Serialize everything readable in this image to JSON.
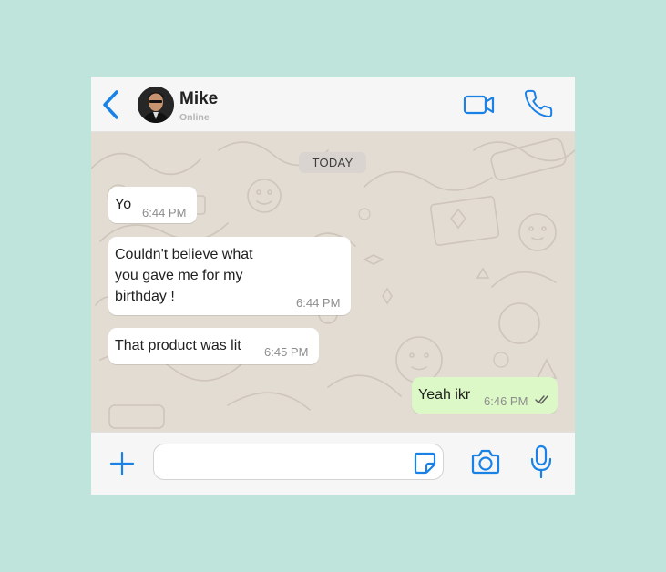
{
  "header": {
    "contact_name": "Mike",
    "contact_status": "Online",
    "icons": [
      "back-chevron-icon",
      "avatar",
      "video-call-icon",
      "phone-call-icon"
    ]
  },
  "chat": {
    "date_divider": "TODAY",
    "messages": [
      {
        "direction": "incoming",
        "text": "Yo",
        "time": "6:44 PM"
      },
      {
        "direction": "incoming",
        "lines": [
          "Couldn't believe what",
          "you gave me for my",
          "birthday !"
        ],
        "time": "6:44 PM"
      },
      {
        "direction": "incoming",
        "text": "That product was lit",
        "time": "6:45 PM"
      },
      {
        "direction": "outgoing",
        "text": "Yeah ikr",
        "time": "6:46 PM",
        "status": "read"
      }
    ]
  },
  "composer": {
    "input_value": "",
    "icons": [
      "plus-icon",
      "sticker-icon",
      "camera-icon",
      "microphone-icon"
    ]
  },
  "colors": {
    "page_background": "#bfe4dc",
    "accent": "#1a82e6",
    "chat_wallpaper": "#e3dcd3",
    "outgoing_bubble": "#dcf8c6",
    "incoming_bubble": "#ffffff"
  }
}
